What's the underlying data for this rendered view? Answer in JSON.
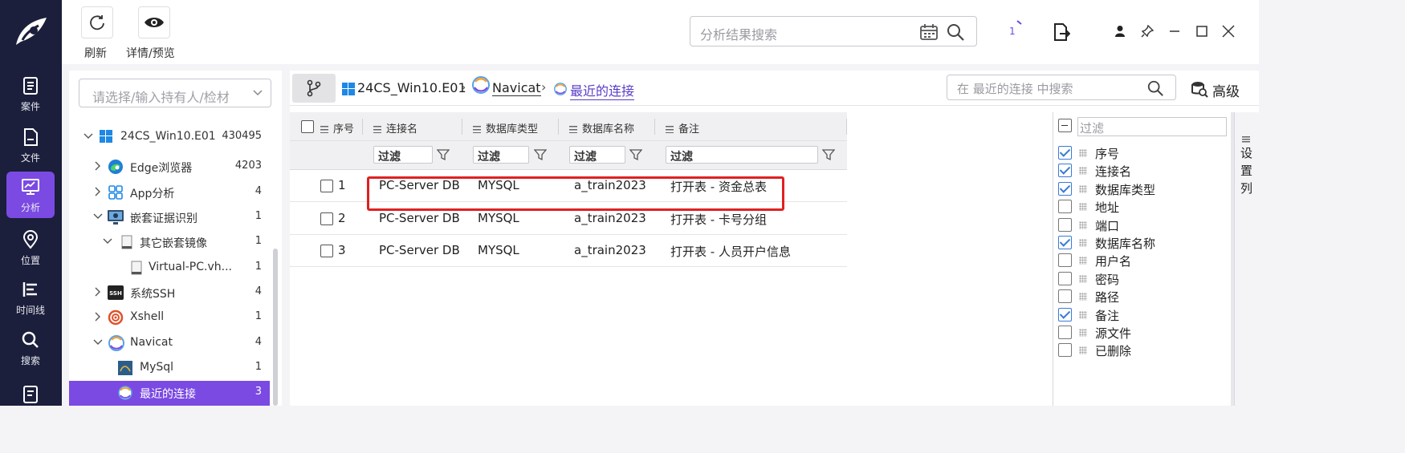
{
  "rail": {
    "items": [
      {
        "label": "案件",
        "icon": "case-icon"
      },
      {
        "label": "文件",
        "icon": "file-icon"
      },
      {
        "label": "分析",
        "icon": "analysis-icon",
        "active": true
      },
      {
        "label": "位置",
        "icon": "location-icon"
      },
      {
        "label": "时间线",
        "icon": "timeline-icon"
      },
      {
        "label": "搜索",
        "icon": "search-icon"
      }
    ]
  },
  "toolbar": {
    "refresh_label": "刷新",
    "details_label": "详情/预览",
    "search_placeholder": "分析结果搜索",
    "task_count": "1"
  },
  "tree": {
    "search_placeholder": "请选择/输入持有人/检材",
    "items": [
      {
        "label": "24CS_Win10.E01",
        "count": "430495"
      },
      {
        "label": "Edge浏览器",
        "count": "4203"
      },
      {
        "label": "App分析",
        "count": "4"
      },
      {
        "label": "嵌套证据识别",
        "count": "1"
      },
      {
        "label": "其它嵌套镜像",
        "count": "1"
      },
      {
        "label": "Virtual-PC.vh...",
        "count": "1"
      },
      {
        "label": "系统SSH",
        "count": "4"
      },
      {
        "label": "Xshell",
        "count": "1"
      },
      {
        "label": "Navicat",
        "count": "4"
      },
      {
        "label": "MySql",
        "count": "1"
      },
      {
        "label": "最近的连接",
        "count": "3",
        "selected": true
      }
    ]
  },
  "breadcrumb": {
    "items": [
      "24CS_Win10.E01",
      "Navicat",
      "最近的连接"
    ],
    "search_placeholder": "在 最近的连接 中搜索",
    "advanced_label": "高级"
  },
  "grid": {
    "columns": [
      "序号",
      "连接名",
      "数据库类型",
      "数据库名称",
      "备注"
    ],
    "filter_label": "过滤",
    "rows": [
      {
        "id": "1",
        "name": "PC-Server DB",
        "type": "MYSQL",
        "db": "a_train2023",
        "note": "打开表 - 资金总表"
      },
      {
        "id": "2",
        "name": "PC-Server DB",
        "type": "MYSQL",
        "db": "a_train2023",
        "note": "打开表 - 卡号分组"
      },
      {
        "id": "3",
        "name": "PC-Server DB",
        "type": "MYSQL",
        "db": "a_train2023",
        "note": "打开表 - 人员开户信息"
      }
    ]
  },
  "column_chooser": {
    "filter_placeholder": "过滤",
    "side_tab_label": "设置列",
    "items": [
      {
        "label": "序号",
        "checked": true
      },
      {
        "label": "连接名",
        "checked": true
      },
      {
        "label": "数据库类型",
        "checked": true
      },
      {
        "label": "地址",
        "checked": false
      },
      {
        "label": "端口",
        "checked": false
      },
      {
        "label": "数据库名称",
        "checked": true
      },
      {
        "label": "用户名",
        "checked": false
      },
      {
        "label": "密码",
        "checked": false
      },
      {
        "label": "路径",
        "checked": false
      },
      {
        "label": "备注",
        "checked": true
      },
      {
        "label": "源文件",
        "checked": false
      },
      {
        "label": "已删除",
        "checked": false
      }
    ]
  },
  "colors": {
    "rail_bg": "#1b1f3b",
    "accent": "#7b4ae2",
    "highlight_box": "#e02020",
    "check_blue": "#3a7bd5"
  }
}
